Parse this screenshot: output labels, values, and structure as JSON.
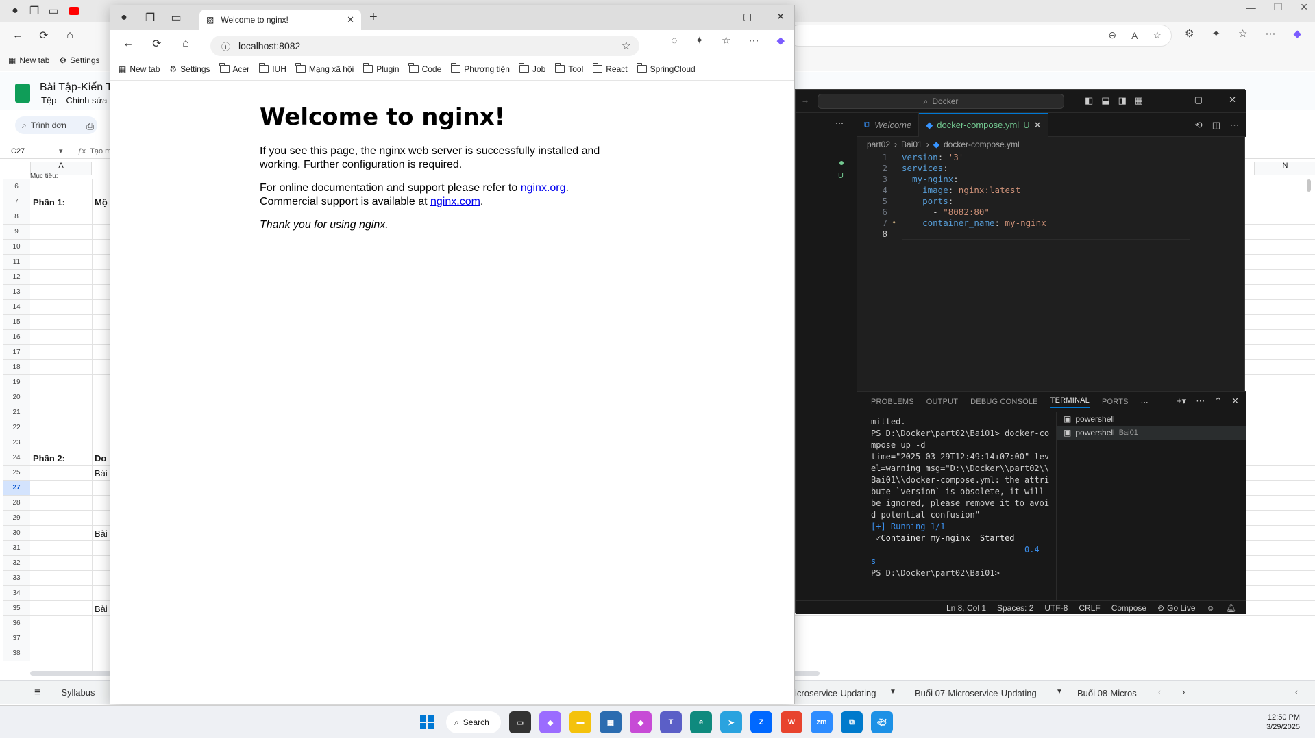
{
  "background_browser": {
    "fav_items": [
      {
        "label": "New tab"
      },
      {
        "label": "Settings"
      }
    ],
    "sheet": {
      "title": "Bài Tập-Kiến T",
      "menu": [
        "Tệp",
        "Chỉnh sửa"
      ],
      "search_placeholder": "Trình đơn",
      "cell_ref": "C27",
      "formula_hint": "Tạo m",
      "column_a": "A",
      "column_n": "N",
      "partial_header": "Mục tiêu:",
      "rows": [
        {
          "num": "6"
        },
        {
          "num": "7",
          "a": "Phần 1:",
          "b": "Mộ"
        },
        {
          "num": "8"
        },
        {
          "num": "9"
        },
        {
          "num": "10"
        },
        {
          "num": "11"
        },
        {
          "num": "12"
        },
        {
          "num": "13"
        },
        {
          "num": "14"
        },
        {
          "num": "15"
        },
        {
          "num": "16"
        },
        {
          "num": "17"
        },
        {
          "num": "18"
        },
        {
          "num": "19"
        },
        {
          "num": "20"
        },
        {
          "num": "21"
        },
        {
          "num": "22"
        },
        {
          "num": "23"
        },
        {
          "num": "24",
          "a": "Phần 2:",
          "b": "Do"
        },
        {
          "num": "25",
          "b": "Bài"
        },
        {
          "num": "27"
        },
        {
          "num": "28"
        },
        {
          "num": "29"
        },
        {
          "num": "30",
          "b": "Bài"
        },
        {
          "num": "31"
        },
        {
          "num": "32"
        },
        {
          "num": "33"
        },
        {
          "num": "34"
        },
        {
          "num": "35",
          "b": "Bài"
        },
        {
          "num": "36"
        },
        {
          "num": "37"
        },
        {
          "num": "38"
        }
      ],
      "tabs": [
        "Syllabus",
        "icroservice-Updating",
        "Buổi 07-Microservice-Updating",
        "Buổi 08-Micros"
      ]
    }
  },
  "front_browser": {
    "tab_title": "Welcome to nginx!",
    "address": "localhost:8082",
    "favorites": [
      "New tab",
      "Settings",
      "Acer",
      "IUH",
      "Mạng xã hội",
      "Plugin",
      "Code",
      "Phương tiện",
      "Job",
      "Tool",
      "React",
      "SpringCloud"
    ],
    "page": {
      "heading": "Welcome to nginx!",
      "p1": "If you see this page, the nginx web server is successfully installed and working. Further configuration is required.",
      "p2_prefix": "For online documentation and support please refer to ",
      "link1": "nginx.org",
      "p2_mid": ".",
      "p2_line2": "Commercial support is available at ",
      "link2": "nginx.com",
      "p2_end": ".",
      "p3": "Thank you for using nginx."
    }
  },
  "vscode": {
    "search": "Docker",
    "tabs": [
      {
        "label": "Welcome"
      },
      {
        "label": "docker-compose.yml",
        "badge": "U"
      }
    ],
    "breadcrumb": [
      "part02",
      "Bai01",
      "docker-compose.yml"
    ],
    "explorer_badge": "U",
    "code_lines": [
      {
        "n": "1",
        "key": "version",
        "val": "'3'"
      },
      {
        "n": "2",
        "key": "services",
        "val": ""
      },
      {
        "n": "3",
        "key": "  my-nginx",
        "val": ""
      },
      {
        "n": "4",
        "key": "    image",
        "val": "nginx:latest"
      },
      {
        "n": "5",
        "key": "    ports",
        "val": ""
      },
      {
        "n": "6",
        "key": "      - ",
        "val": "\"8082:80\""
      },
      {
        "n": "7",
        "key": "    container_name",
        "val": "my-nginx"
      },
      {
        "n": "8",
        "key": "",
        "val": ""
      }
    ],
    "panel_tabs": [
      "PROBLEMS",
      "OUTPUT",
      "DEBUG CONSOLE",
      "TERMINAL",
      "PORTS"
    ],
    "terminal_lines": [
      "mitted.",
      "PS D:\\Docker\\part02\\Bai01> docker-co",
      "mpose up -d",
      "time=\"2025-03-29T12:49:14+07:00\" lev",
      "el=warning msg=\"D:\\\\Docker\\\\part02\\\\",
      "Bai01\\\\docker-compose.yml: the attri",
      "bute `version` is obsolete, it will",
      "be ignored, please remove it to avoi",
      "d potential confusion\"",
      "[+] Running 1/1",
      " ✓Container my-nginx  Started",
      "",
      "                               0.4",
      "s",
      "PS D:\\Docker\\part02\\Bai01> "
    ],
    "terminals": [
      {
        "label": "powershell",
        "sub": ""
      },
      {
        "label": "powershell",
        "sub": "Bai01"
      }
    ],
    "status": {
      "position": "Ln 8, Col 1",
      "spaces": "Spaces: 2",
      "encoding": "UTF-8",
      "eol": "CRLF",
      "lang": "Compose",
      "golive": "Go Live"
    }
  },
  "taskbar": {
    "search": "Search",
    "time": "12:50 PM",
    "date": "3/29/2025"
  }
}
